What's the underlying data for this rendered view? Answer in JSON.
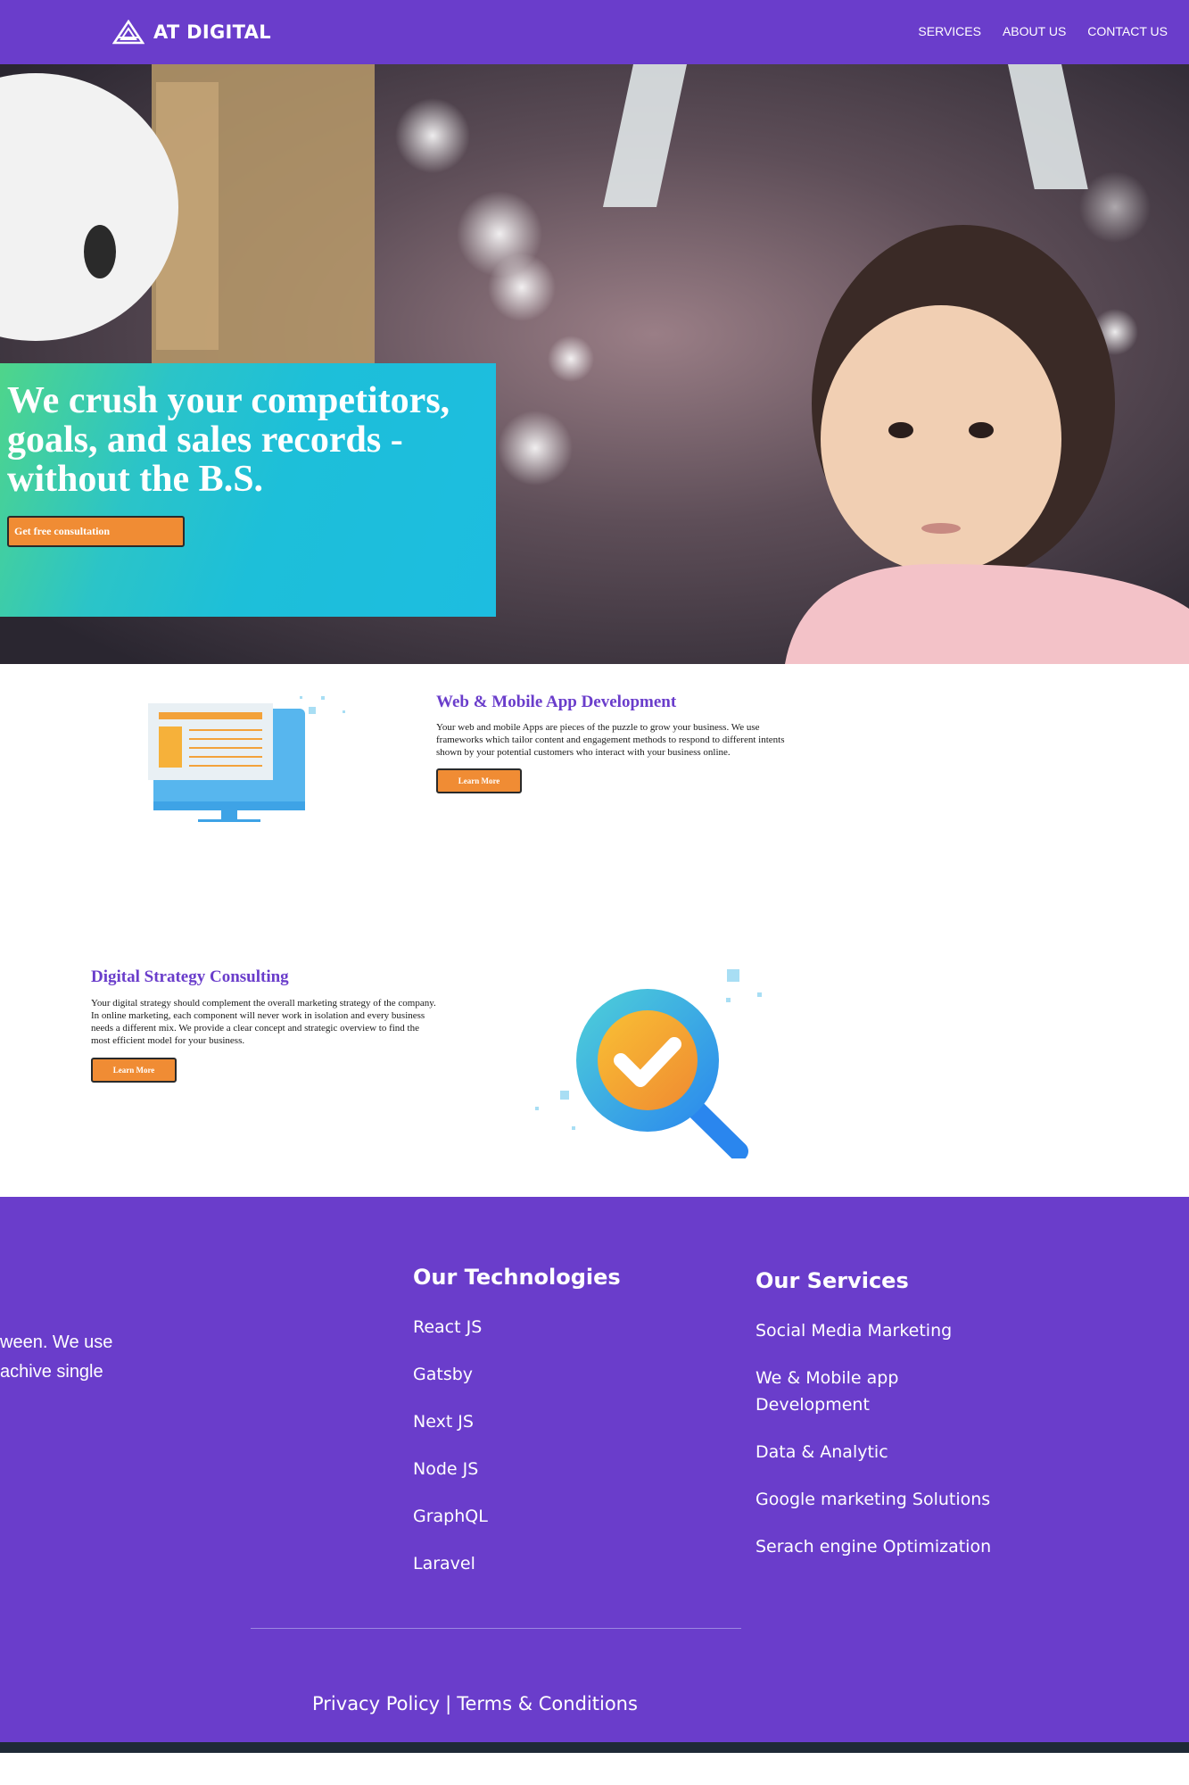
{
  "brand": {
    "name": "AT DIGITAL",
    "nav_color": "#6a3dcb"
  },
  "nav": {
    "links": [
      "SERVICES",
      "ABOUT US",
      "CONTACT US"
    ]
  },
  "hero": {
    "title": "We crush your competitors, goals, and sales records - without the B.S.",
    "cta": "Get free consultation"
  },
  "services": [
    {
      "title": "Web & Mobile App Development",
      "description": "Your web and mobile Apps are pieces of the puzzle to grow your business. We use frameworks which tailor content and engagement methods to respond to different intents shown by your potential customers who interact with your business online.",
      "button": "Learn More",
      "icon": "monitor-icon"
    },
    {
      "title": "Digital Strategy Consulting",
      "description": "Your digital strategy should complement the overall marketing strategy of the company. In online marketing, each component will never work in isolation and every business needs a different mix. We provide a clear concept and strategic overview to find the most efficient model for your business.",
      "button": "Learn More",
      "icon": "magnifier-check-icon"
    }
  ],
  "footer": {
    "left_text_lines": [
      "ween. We use",
      " achive single"
    ],
    "technologies": {
      "title": "Our Technologies",
      "items": [
        "React JS",
        "Gatsby",
        "Next JS",
        "Node JS",
        "GraphQL",
        "Laravel"
      ]
    },
    "services": {
      "title": "Our Services",
      "items": [
        "Social Media Marketing",
        "We & Mobile app Development",
        "Data & Analytic",
        "Google marketing Solutions",
        "Serach engine Optimization"
      ]
    },
    "legal": {
      "privacy": "Privacy Policy",
      "separator": "|",
      "terms": "Terms & Conditions"
    }
  }
}
